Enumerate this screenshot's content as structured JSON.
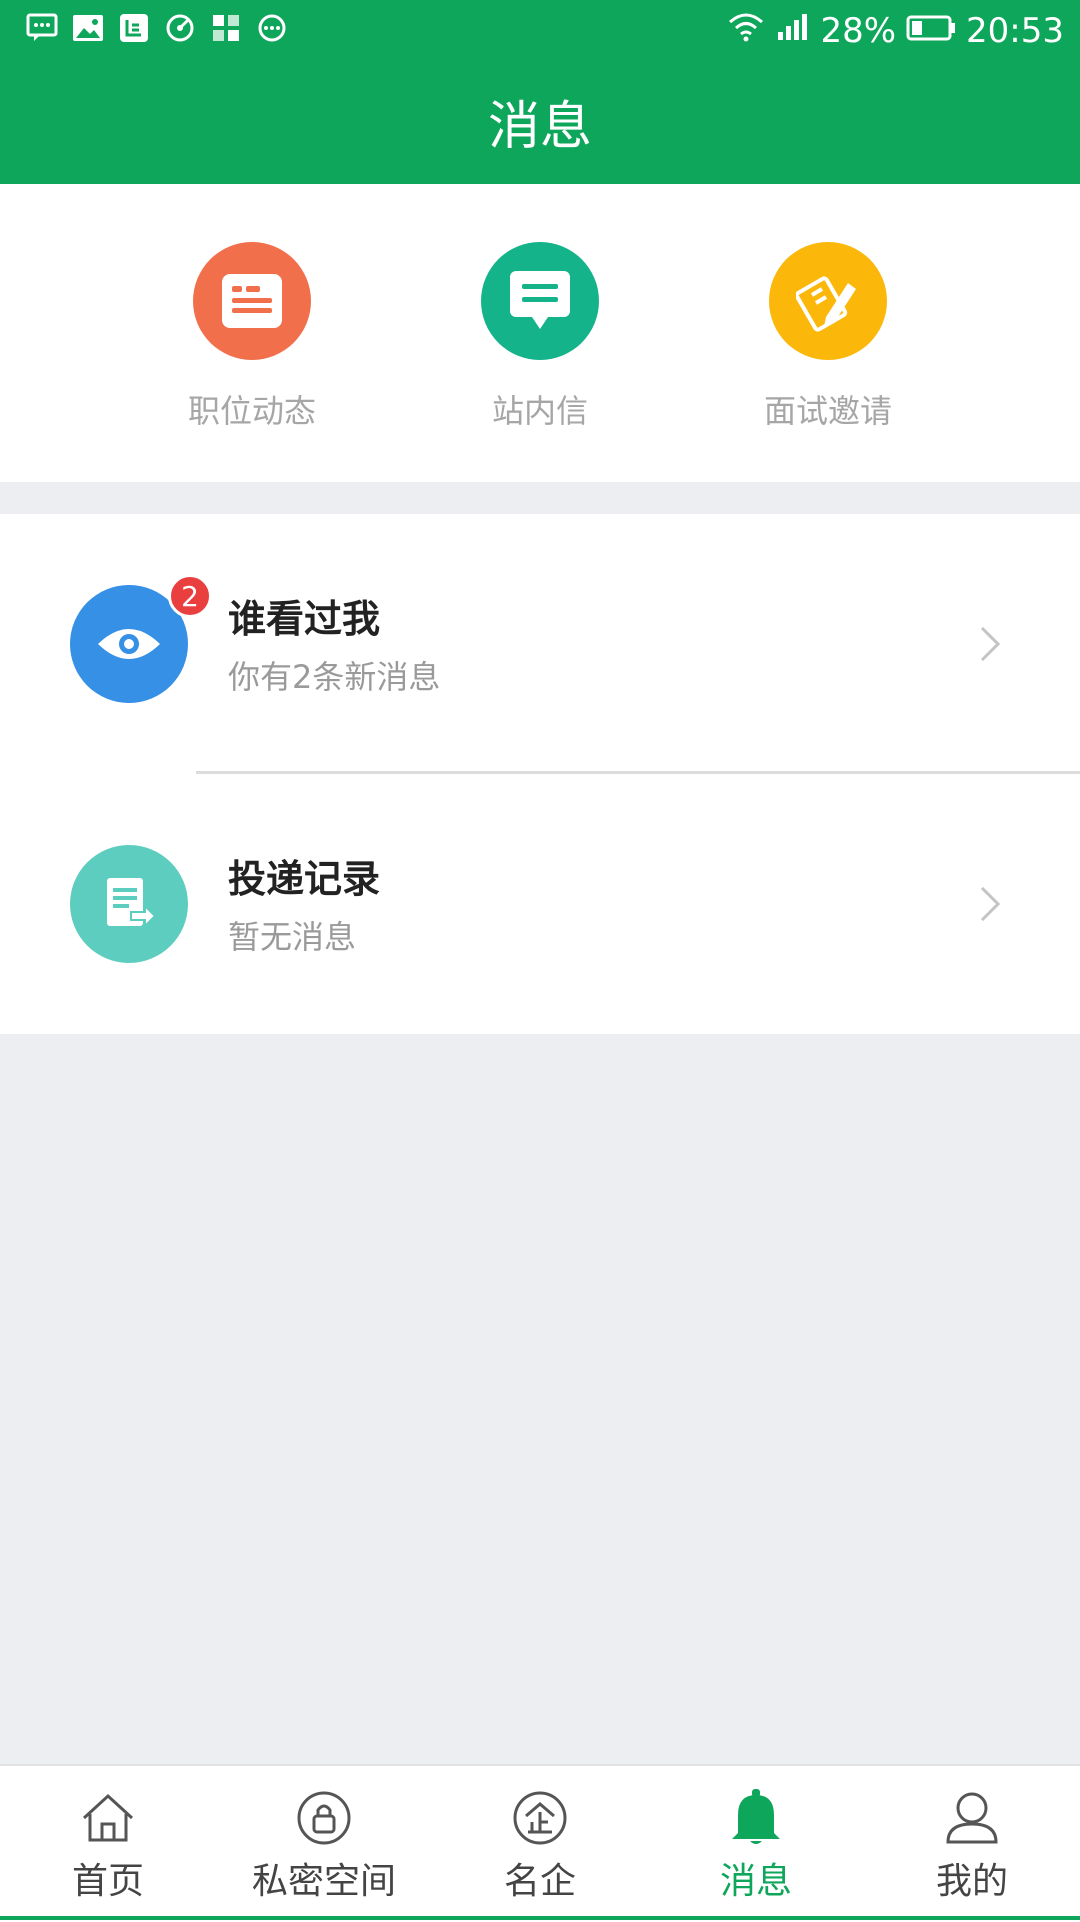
{
  "status_bar": {
    "notification_icons": [
      "message-icon",
      "image-icon",
      "news-icon",
      "speed-icon",
      "apps-icon",
      "more-icon"
    ],
    "battery_percent": "28%",
    "time": "20:53"
  },
  "header": {
    "title": "消息",
    "background": "#0ea65a"
  },
  "quick_actions": [
    {
      "label": "职位动态",
      "icon": "document-list-icon",
      "color": "#f26f4b"
    },
    {
      "label": "站内信",
      "icon": "chat-message-icon",
      "color": "#14b38a"
    },
    {
      "label": "面试邀请",
      "icon": "pencil-edit-icon",
      "color": "#fbb80b"
    }
  ],
  "messages": [
    {
      "title": "谁看过我",
      "subtitle": "你有2条新消息",
      "badge": "2",
      "icon": "eye-icon",
      "color": "#3590e6"
    },
    {
      "title": "投递记录",
      "subtitle": "暂无消息",
      "icon": "document-send-icon",
      "color": "#5dcdc0"
    }
  ],
  "tabbar": {
    "tabs": [
      {
        "label": "首页",
        "icon": "home-icon"
      },
      {
        "label": "私密空间",
        "icon": "lock-icon"
      },
      {
        "label": "名企",
        "icon": "enterprise-icon"
      },
      {
        "label": "消息",
        "icon": "bell-icon",
        "active": true
      },
      {
        "label": "我的",
        "icon": "person-icon"
      }
    ],
    "active_color": "#0ea65a"
  }
}
